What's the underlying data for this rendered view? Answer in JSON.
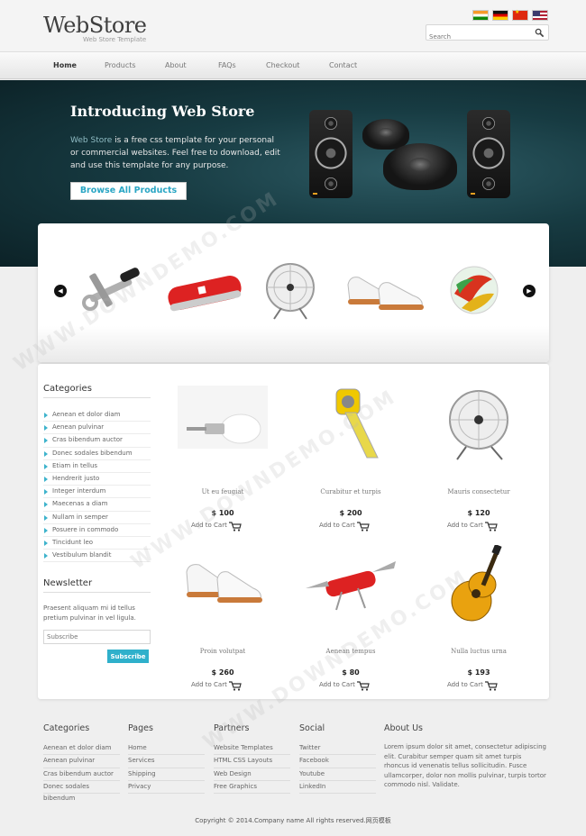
{
  "header": {
    "logo": "WebStore",
    "tagline": "Web Store Template",
    "search_placeholder": "Search",
    "flags": [
      "india-flag-icon",
      "germany-flag-icon",
      "china-flag-icon",
      "usa-flag-icon"
    ]
  },
  "nav": {
    "items": [
      "Home",
      "Products",
      "About",
      "FAQs",
      "Checkout",
      "Contact"
    ],
    "active": "Home"
  },
  "hero": {
    "title": "Introducing Web Store",
    "text_highlight": "Web Store",
    "text_rest": " is a free css template for your personal or commercial websites. Feel free to download, edit and use this template for any purpose.",
    "button": "Browse All Products"
  },
  "slider": {
    "items": [
      "tools-icon",
      "pocket-knife-icon",
      "desk-fan-icon",
      "white-shoes-icon",
      "glass-marble-icon"
    ]
  },
  "sidebar": {
    "categories_title": "Categories",
    "categories": [
      "Aenean et dolor diam",
      "Aenean pulvinar",
      "Cras bibendum auctor",
      "Donec sodales bibendum",
      "Etiam in tellus",
      "Hendrerit justo",
      "Integer interdum",
      "Maecenas a diam",
      "Nullam in semper",
      "Posuere in commodo",
      "Tincidunt leo",
      "Vestibulum blandit"
    ],
    "newsletter_title": "Newsletter",
    "newsletter_text": "Praesent aliquam mi id tellus pretium pulvinar in vel ligula.",
    "subscribe_placeholder": "Subscribe",
    "subscribe_button": "Subscribe"
  },
  "products": [
    {
      "name": "Ut eu feugiat",
      "price": "$ 100",
      "cart": "Add to Cart",
      "icon": "light-bulb-icon"
    },
    {
      "name": "Curabitur et turpis",
      "price": "$ 200",
      "cart": "Add to Cart",
      "icon": "tape-measure-icon"
    },
    {
      "name": "Mauris consectetur",
      "price": "$ 120",
      "cart": "Add to Cart",
      "icon": "desk-fan-icon"
    },
    {
      "name": "Proin volutpat",
      "price": "$ 260",
      "cart": "Add to Cart",
      "icon": "white-shoes-icon"
    },
    {
      "name": "Aenean tempus",
      "price": "$ 80",
      "cart": "Add to Cart",
      "icon": "pocket-knife-icon"
    },
    {
      "name": "Nulla luctus urna",
      "price": "$ 193",
      "cart": "Add to Cart",
      "icon": "acoustic-guitar-icon"
    }
  ],
  "footer": {
    "categories": {
      "title": "Categories",
      "items": [
        "Aenean et dolor diam",
        "Aenean pulvinar",
        "Cras bibendum auctor",
        "Donec sodales bibendum"
      ]
    },
    "pages": {
      "title": "Pages",
      "items": [
        "Home",
        "Services",
        "Shipping",
        "Privacy"
      ]
    },
    "partners": {
      "title": "Partners",
      "items": [
        "Website Templates",
        "HTML CSS Layouts",
        "Web Design",
        "Free Graphics"
      ]
    },
    "social": {
      "title": "Social",
      "items": [
        "Twitter",
        "Facebook",
        "Youtube",
        "LinkedIn"
      ]
    },
    "about": {
      "title": "About Us",
      "text": "Lorem ipsum dolor sit amet, consectetur adipiscing elit. Curabitur semper quam sit amet turpis rhoncus id venenatis tellus sollicitudin. Fusce ullamcorper, dolor non mollis pulvinar, turpis tortor commodo nisl. Validate."
    },
    "copyright": "Copyright © 2014.Company name All rights reserved.网页模板"
  },
  "watermark": "WWW.DOWNDEMO.COM",
  "colors": {
    "accent": "#2fb0cb",
    "hero_bg": "#173b42",
    "page_bg": "#efefef"
  }
}
